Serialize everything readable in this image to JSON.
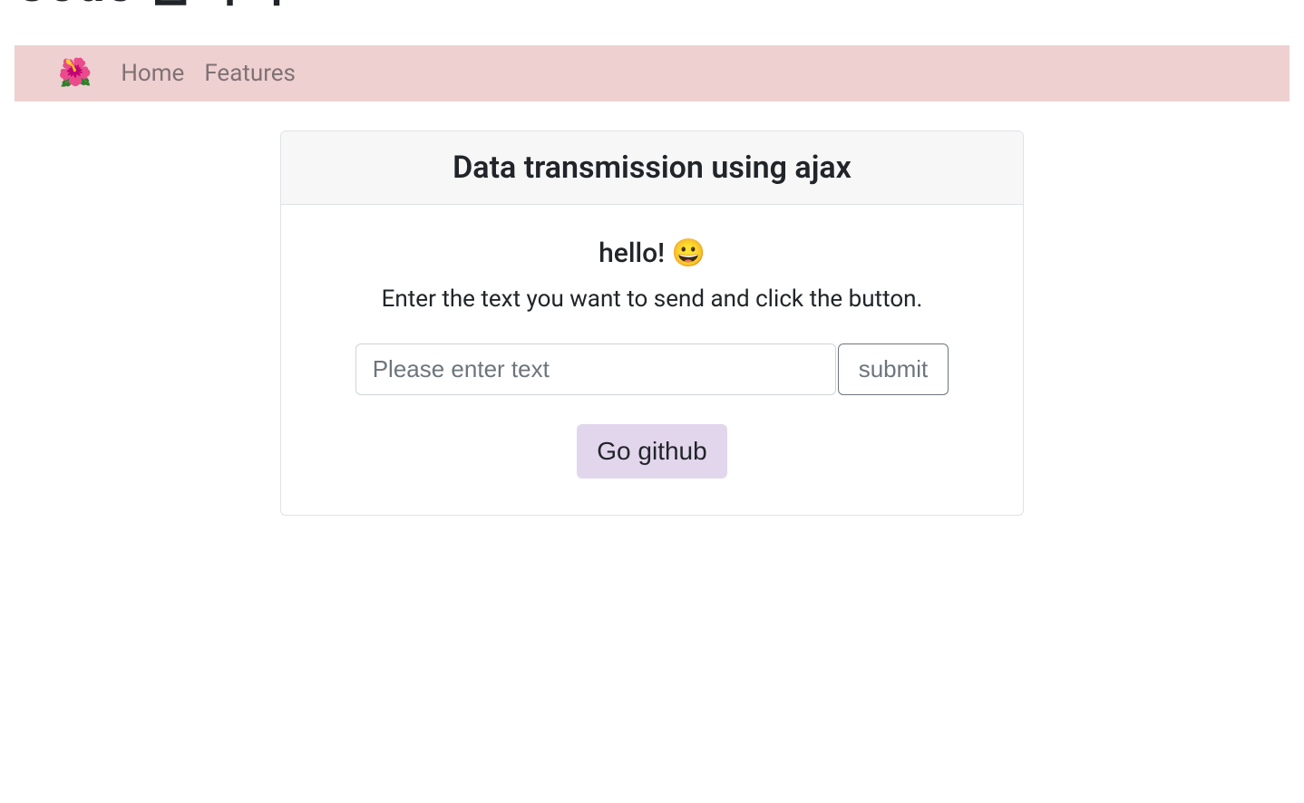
{
  "page_title": "Code 넘기기",
  "navbar": {
    "brand_icon": "🌺",
    "links": [
      {
        "label": "Home"
      },
      {
        "label": "Features"
      }
    ]
  },
  "card": {
    "header": "Data transmission using ajax",
    "greeting": "hello! 😀",
    "instruction": "Enter the text you want to send and click the button.",
    "input_placeholder": "Please enter text",
    "input_value": "",
    "submit_label": "submit",
    "github_label": "Go github"
  }
}
